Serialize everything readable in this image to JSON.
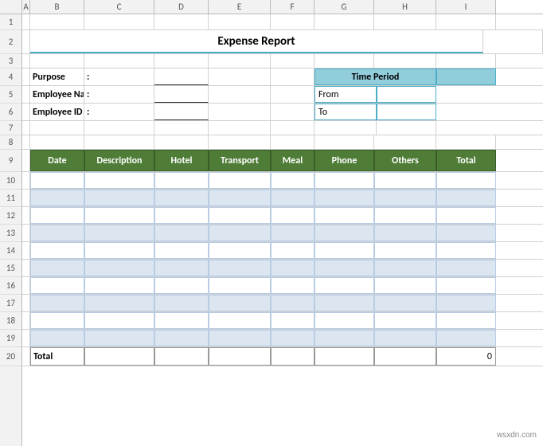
{
  "title": "Expense Report",
  "columns": [
    "A",
    "B",
    "C",
    "D",
    "E",
    "F",
    "G",
    "H",
    "I"
  ],
  "rows": [
    "1",
    "2",
    "3",
    "4",
    "5",
    "6",
    "7",
    "8",
    "9",
    "10",
    "11",
    "12",
    "13",
    "14",
    "15",
    "16",
    "17",
    "18",
    "19",
    "20"
  ],
  "form": {
    "purpose_label": "Purpose",
    "employee_name_label": "Employee Name",
    "employee_id_label": "Employee ID",
    "colon": ":"
  },
  "time_period": {
    "header": "Time Period",
    "from_label": "From",
    "to_label": "To"
  },
  "table": {
    "headers": [
      "Date",
      "Description",
      "Hotel",
      "Transport",
      "Meal",
      "Phone",
      "Others",
      "Total"
    ],
    "total_label": "Total",
    "total_value": "0"
  },
  "watermark": "wsxdn.com"
}
